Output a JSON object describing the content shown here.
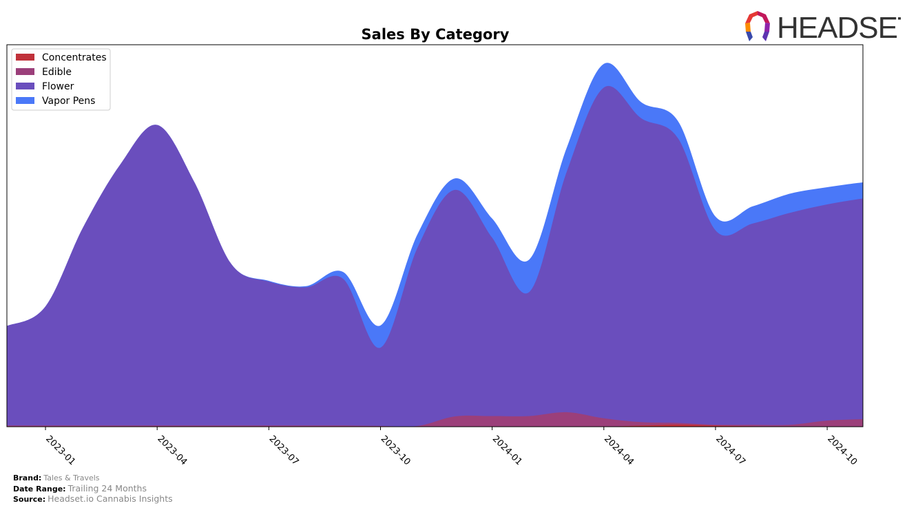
{
  "chart_data": {
    "type": "area",
    "stacked": true,
    "title": "Sales By Category",
    "xlabel": "",
    "ylabel": "",
    "x": [
      "2022-12",
      "2023-01",
      "2023-02",
      "2023-03",
      "2023-04",
      "2023-05",
      "2023-06",
      "2023-07",
      "2023-08",
      "2023-09",
      "2023-10",
      "2023-11",
      "2023-12",
      "2024-01",
      "2024-02",
      "2024-03",
      "2024-04",
      "2024-05",
      "2024-06",
      "2024-07",
      "2024-08",
      "2024-09",
      "2024-10",
      "2024-11"
    ],
    "x_tick_labels": [
      "2023-01",
      "2023-04",
      "2023-07",
      "2023-10",
      "2024-01",
      "2024-04",
      "2024-07",
      "2024-10"
    ],
    "y_ticks_visible": false,
    "ylim": [
      0,
      100
    ],
    "grid": false,
    "legend_position": "top-left",
    "series": [
      {
        "name": "Concentrates",
        "color": "#c0313a",
        "values": [
          0,
          0,
          0,
          0,
          0,
          0,
          0,
          0,
          0,
          0,
          0,
          0,
          0,
          0,
          0,
          0,
          0,
          0.3,
          0.6,
          0.3,
          0.1,
          0,
          0,
          0
        ]
      },
      {
        "name": "Edible",
        "color": "#9b3f7a",
        "values": [
          0.3,
          0.3,
          0.3,
          0.3,
          0.3,
          0.3,
          0.3,
          0.3,
          0.3,
          0.3,
          0.2,
          0.2,
          2.7,
          2.8,
          2.8,
          3.8,
          2.2,
          0.9,
          0.4,
          0.2,
          0.4,
          0.5,
          1.6,
          2
        ]
      },
      {
        "name": "Flower",
        "color": "#6a4ebd",
        "values": [
          26.2,
          31.2,
          51.7,
          68.2,
          78.7,
          63.7,
          42.2,
          37.7,
          36.2,
          38.4,
          20.5,
          46.8,
          59.3,
          46.7,
          32.5,
          62.9,
          86.6,
          79.6,
          74.4,
          50.9,
          52.7,
          55.5,
          56.6,
          57.8
        ]
      },
      {
        "name": "Vapor Pens",
        "color": "#4a78f8",
        "values": [
          0,
          0,
          0,
          0,
          0,
          0,
          0,
          0.2,
          0.3,
          1.8,
          5.8,
          3.5,
          3,
          5,
          8.5,
          6.3,
          6.2,
          4.2,
          4.5,
          3.6,
          4.5,
          5,
          4.5,
          4.2
        ]
      }
    ]
  },
  "legend": {
    "items": [
      {
        "label": "Concentrates",
        "color": "#c0313a"
      },
      {
        "label": "Edible",
        "color": "#9b3f7a"
      },
      {
        "label": "Flower",
        "color": "#6a4ebd"
      },
      {
        "label": "Vapor Pens",
        "color": "#4a78f8"
      }
    ]
  },
  "logo": {
    "text": "HEADSET"
  },
  "footer": {
    "brand_label": "Brand:",
    "brand_value": "Tales & Travels",
    "date_range_label": "Date Range:",
    "date_range_value": "Trailing 24 Months",
    "source_label": "Source:",
    "source_value": "Headset.io Cannabis Insights"
  }
}
